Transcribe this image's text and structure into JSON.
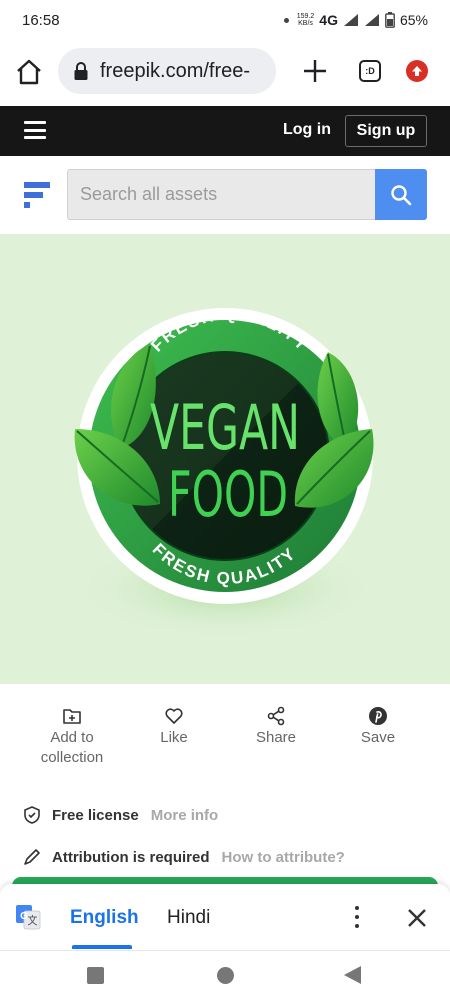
{
  "status_bar": {
    "time": "16:58",
    "net_speed_value": "159.2",
    "net_speed_unit": "KB/s",
    "network": "4G",
    "battery": "65%"
  },
  "browser": {
    "url": "freepik.com/free-",
    "tabs_label": ":D"
  },
  "site_nav": {
    "login_label": "Log in",
    "signup_label": "Sign up"
  },
  "search": {
    "placeholder": "Search all assets"
  },
  "hero": {
    "badge_top_arc": "FRESH QUALITY",
    "badge_line1": "VEGAN",
    "badge_line2": "FOOD",
    "badge_bottom_arc": "FRESH QUALITY"
  },
  "actions": {
    "collection_line1": "Add to",
    "collection_line2": "collection",
    "like": "Like",
    "share": "Share",
    "save": "Save"
  },
  "license": {
    "free_label": "Free license",
    "more_info": "More info",
    "attribution_label": "Attribution is required",
    "attribute_link": "How to attribute?"
  },
  "translate": {
    "lang_active": "English",
    "lang_other": "Hindi"
  },
  "colors": {
    "accent_blue": "#4d8ef0",
    "translate_blue": "#1a73e8",
    "nav_black": "#161616",
    "hero_bg": "#dff1d7",
    "badge_green": "#2ea043"
  }
}
